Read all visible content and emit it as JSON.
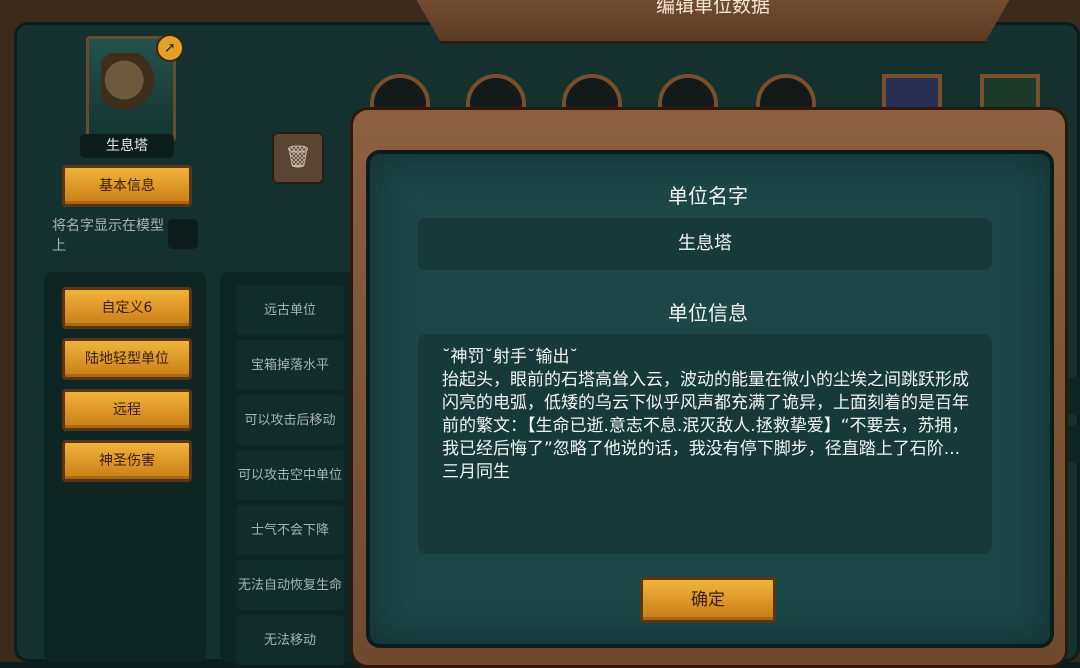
{
  "window": {
    "title": "编辑单位数据"
  },
  "unit": {
    "name": "生息塔"
  },
  "sidebar": {
    "basic_info_label": "基本信息",
    "show_name_label": "将名字显示在模型上",
    "categories": [
      "自定义6",
      "陆地轻型单位",
      "远程",
      "神圣伤害"
    ]
  },
  "attributes": [
    "远古单位",
    "宝箱掉落水平",
    "可以攻击后移动",
    "可以攻击空中单位",
    "士气不会下降",
    "无法自动恢复生命",
    "无法移动"
  ],
  "dialog": {
    "name_heading": "单位名字",
    "name_value": "生息塔",
    "info_heading": "单位信息",
    "info_text": "˘神罚˘射手˘输出˘\n抬起头，眼前的石塔高耸入云，波动的能量在微小的尘埃之间跳跃形成闪亮的电弧，低矮的乌云下似乎风声都充满了诡异，上面刻着的是百年前的繁文：【生命已逝.意志不息.泯灭敌人.拯救挚爱】“不要去，苏拥，我已经后悔了”忽略了他说的话，我没有停下脚步，径直踏上了石阶...                三月同生",
    "confirm_label": "确定"
  },
  "icons": [
    "trash-icon",
    "settings-badge-icon",
    "unit-portrait-icon"
  ],
  "colors": {
    "gold_button": "#e3a22c",
    "panel_teal": "#1b4747",
    "wood_frame": "#7b5435"
  }
}
